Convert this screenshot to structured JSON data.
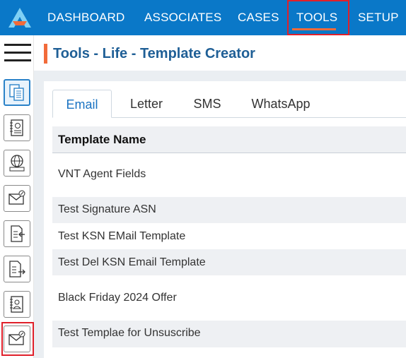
{
  "topnav": {
    "items": [
      {
        "label": "DASHBOARD"
      },
      {
        "label": "ASSOCIATES"
      },
      {
        "label": "CASES"
      },
      {
        "label": "TOOLS"
      },
      {
        "label": "SETUP"
      }
    ],
    "active": "TOOLS",
    "colors": {
      "bar": "#0a78c8",
      "accent": "#f26b3a",
      "highlight": "#e0202a"
    }
  },
  "sidebar": {
    "buttons": [
      {
        "icon": "documents-icon",
        "selected": true
      },
      {
        "icon": "contact-book-icon",
        "selected": false
      },
      {
        "icon": "web-globe-icon",
        "selected": false
      },
      {
        "icon": "email-send-icon",
        "selected": false
      },
      {
        "icon": "document-import-icon",
        "selected": false
      },
      {
        "icon": "document-export-icon",
        "selected": false
      },
      {
        "icon": "id-document-icon",
        "selected": false
      },
      {
        "icon": "email-template-icon",
        "selected": false,
        "highlighted": true
      }
    ]
  },
  "page": {
    "title": "Tools - Life - Template Creator"
  },
  "tabs": {
    "items": [
      "Email",
      "Letter",
      "SMS",
      "WhatsApp"
    ],
    "active": "Email"
  },
  "table": {
    "header": "Template Name",
    "rows": [
      "VNT Agent Fields",
      "Test Signature ASN",
      "Test KSN EMail Template",
      "Test Del KSN Email Template",
      "Black Friday 2024 Offer",
      "Test Templae for Unsuscribe"
    ]
  }
}
